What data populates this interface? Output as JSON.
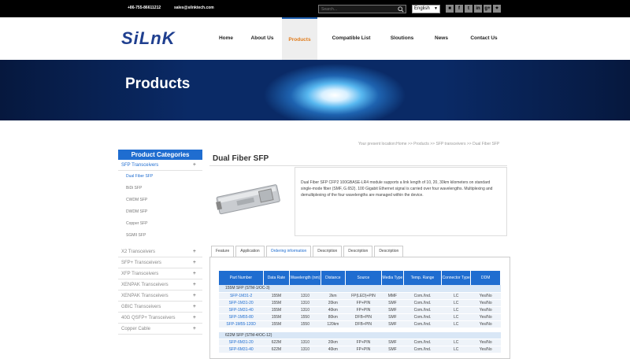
{
  "topbar": {
    "phone": "+86-755-86611212",
    "email": "sales@silnktech.com",
    "search_placeholder": "Search...",
    "language": "English",
    "social_icons": [
      "square-icon",
      "facebook-icon",
      "twitter-icon",
      "linkedin-icon",
      "google-plus-icon",
      "share-icon"
    ]
  },
  "header": {
    "logo": "SiLnK",
    "nav": [
      "Home",
      "About Us",
      "Products",
      "Compatible List",
      "Sloutions",
      "News",
      "Contact Us"
    ],
    "active": "Products"
  },
  "banner": {
    "title": "Products"
  },
  "breadcrumb": "Your present location:Home >> Products >> SFP transceivers >> Dual Fiber SFP",
  "sidebar": {
    "heading": "Product Categories",
    "sections": [
      {
        "label": "SFP Transceivers",
        "sub": [
          "Dual Fiber SFP",
          "BiDi SFP",
          "CWDM SFP",
          "DWDM SFP",
          "Copper SFP",
          "SGMII SFP"
        ]
      },
      {
        "label": "X2 Transceivers"
      },
      {
        "label": "SFP+ Transceivers"
      },
      {
        "label": "XFP Transceivers"
      },
      {
        "label": "XENPAK Transceivers"
      },
      {
        "label": "XENPAK Transceivers"
      },
      {
        "label": "GBIC Transceivers"
      },
      {
        "label": "40G QSFP+ Transceivers"
      },
      {
        "label": "Copper Cable"
      }
    ]
  },
  "page": {
    "title": "Dual Fiber SFP",
    "description": "Dual Fiber SFP CFP2 100GBASE-LR4 module supports a link length of 10, 20, 30km kilometers on standard single-mode fiber (SMF, G.652). 100 Gigabit Ethernet signal is carried over four wavelengths. Multiplexing and demultiplexing of the four wavelengths are managed within the device."
  },
  "tabs": [
    "Feature",
    "Application",
    "Ordering information",
    "Description",
    "Description",
    "Description"
  ],
  "active_tab": "Ordering information",
  "table": {
    "headers": [
      "Part Number",
      "Data Rate",
      "Wavelength (nm)",
      "Distance",
      "Source",
      "Media Type",
      "Temp. Range",
      "Connector Type",
      "DDM"
    ],
    "groups": [
      {
        "title": "155M SFP (STM-1/OC-3)",
        "rows": [
          [
            "SFP-1M31-2",
            "155M",
            "1310",
            "2km",
            "FP(LED)+PIN",
            "MMF",
            "Com./Ind.",
            "LC",
            "Yes/No"
          ],
          [
            "SFP-1M31-20",
            "155M",
            "1310",
            "20km",
            "FP+PIN",
            "SMF",
            "Com./Ind.",
            "LC",
            "Yes/No"
          ],
          [
            "SFP-1M31-40",
            "155M",
            "1310",
            "40km",
            "FP+PIN",
            "SMF",
            "Com./Ind.",
            "LC",
            "Yes/No"
          ],
          [
            "SFP-1M55-80",
            "155M",
            "1550",
            "80km",
            "DFB+PIN",
            "SMF",
            "Com./Ind.",
            "LC",
            "Yes/No"
          ],
          [
            "SFP-1M55-120D",
            "155M",
            "1550",
            "120km",
            "DFB+PIN",
            "SMF",
            "Com./Ind.",
            "LC",
            "Yes/No"
          ]
        ]
      },
      {
        "title": "622M SFP (STM-4/OC-12)",
        "rows": [
          [
            "SFP-6M31-20",
            "622M",
            "1310",
            "20km",
            "FP+PIN",
            "SMF",
            "Com./Ind.",
            "LC",
            "Yes/No"
          ],
          [
            "SFP-6M31-40",
            "622M",
            "1310",
            "40km",
            "FP+PIN",
            "SMF",
            "Com./Ind.",
            "LC",
            "Yes/No"
          ]
        ]
      }
    ]
  }
}
